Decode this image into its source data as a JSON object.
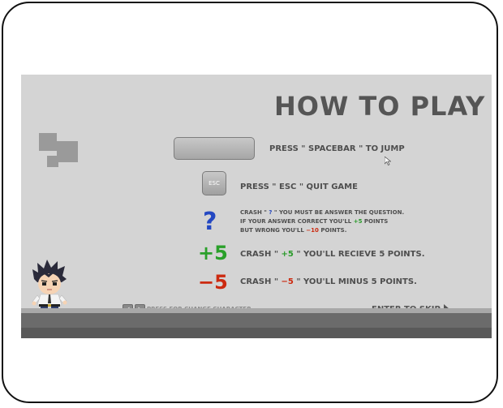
{
  "title": "HOW TO PLAY",
  "spacebar": {
    "pre": "PRESS \"",
    "key": " SPACEBAR ",
    "post": "\" TO JUMP"
  },
  "esc": {
    "key_label": "ESC",
    "pre": "PRESS \"",
    "key": " ESC ",
    "post": "\" QUIT GAME"
  },
  "question": {
    "symbol": "?",
    "line1_pre": "CRASH  \" ",
    "line1_q": "?",
    "line1_post": " \"  YOU MUST BE ANSWER THE QUESTION.",
    "line2_pre": "IF YOUR ANSWER CORRECT YOU'LL ",
    "line2_val": "+5",
    "line2_post": " POINTS",
    "line3_pre": "BUT WRONG YOU'LL ",
    "line3_val": "−10",
    "line3_post": " POINTS."
  },
  "plus": {
    "symbol": "+5",
    "pre": "CRASH \" ",
    "val": "+5",
    "post": " \" YOU'LL RECIEVE 5 POINTS."
  },
  "minus": {
    "symbol": "−5",
    "pre": "CRASH \" ",
    "val": "−5",
    "post": " \" YOU'LL MINUS 5 POINTS."
  },
  "footer": {
    "change_character": "PRESS FOR CHANGE CHARACTER",
    "enter_skip": "ENTER TO SKIP"
  },
  "icons": [
    "arrow-left-icon",
    "arrow-right-icon",
    "play-triangle-icon",
    "mouse-cursor-icon"
  ]
}
